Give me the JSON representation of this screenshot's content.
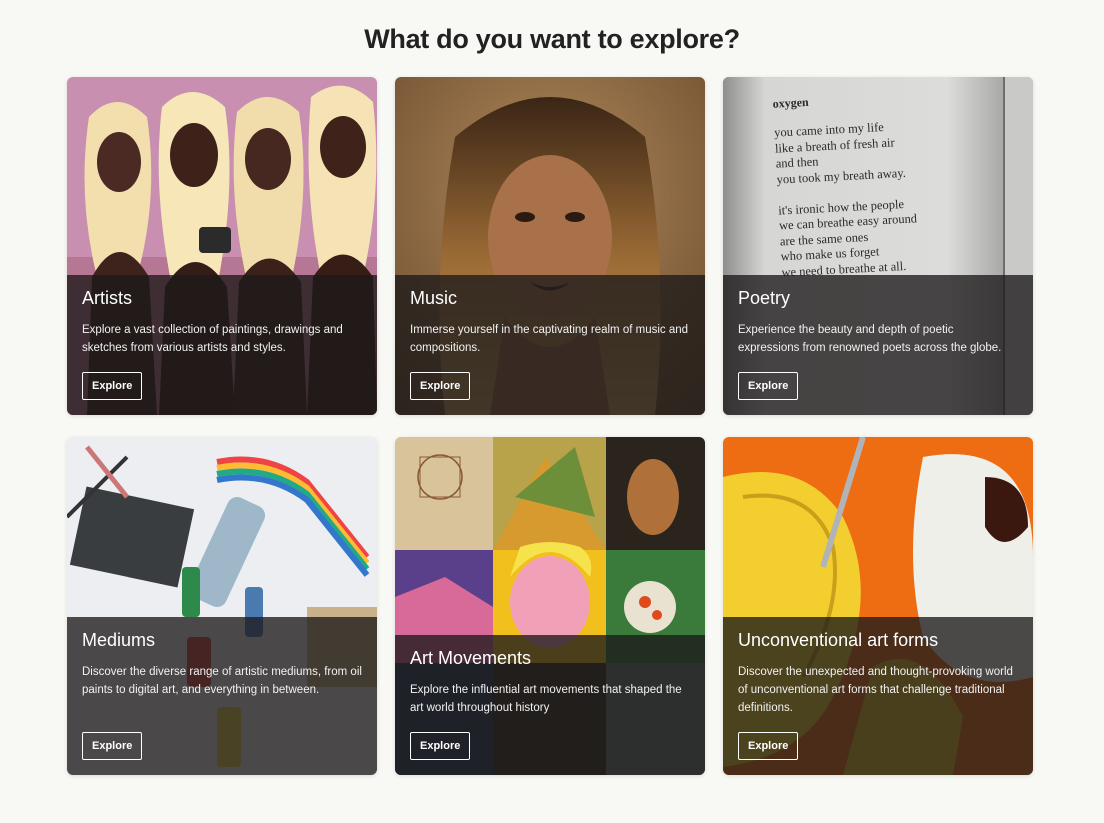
{
  "header": {
    "title": "What do you want to explore?"
  },
  "cards": [
    {
      "title": "Artists",
      "description": "Explore a vast collection of paintings, drawings and sketches from various artists and styles.",
      "button": "Explore",
      "image": "pink-illustration-women"
    },
    {
      "title": "Music",
      "description": "Immerse yourself in the captivating realm of music and compositions.",
      "button": "Explore",
      "image": "singer-portrait"
    },
    {
      "title": "Poetry",
      "description": "Experience the beauty and depth of poetic expressions from renowned poets across the globe.",
      "button": "Explore",
      "image": "poetry-book-page",
      "poem": {
        "heading": "oxygen",
        "lines": [
          "you came into my life",
          "like a breath of fresh air",
          "and then",
          "you took my breath away.",
          "",
          "it's ironic how the people",
          "we can breathe easy around",
          "are the same ones",
          "who make us forget",
          "we need to breathe at all."
        ]
      }
    },
    {
      "title": "Mediums",
      "description": "Discover the diverse range of artistic mediums, from oil paints to digital art, and everything in between.",
      "button": "Explore",
      "image": "art-supplies"
    },
    {
      "title": "Art Movements",
      "description": "Explore the influential art movements that shaped the art world throughout history",
      "button": "Explore",
      "image": "famous-paintings-collage"
    },
    {
      "title": "Unconventional art forms",
      "description": "Discover the unexpected and thought-provoking world of unconventional art forms that challenge traditional definitions.",
      "button": "Explore",
      "image": "banana-and-tape"
    }
  ],
  "colors": {
    "page_background": "#f8f8f4",
    "overlay": "rgba(28,26,26,0.78)",
    "title": "#222222"
  }
}
